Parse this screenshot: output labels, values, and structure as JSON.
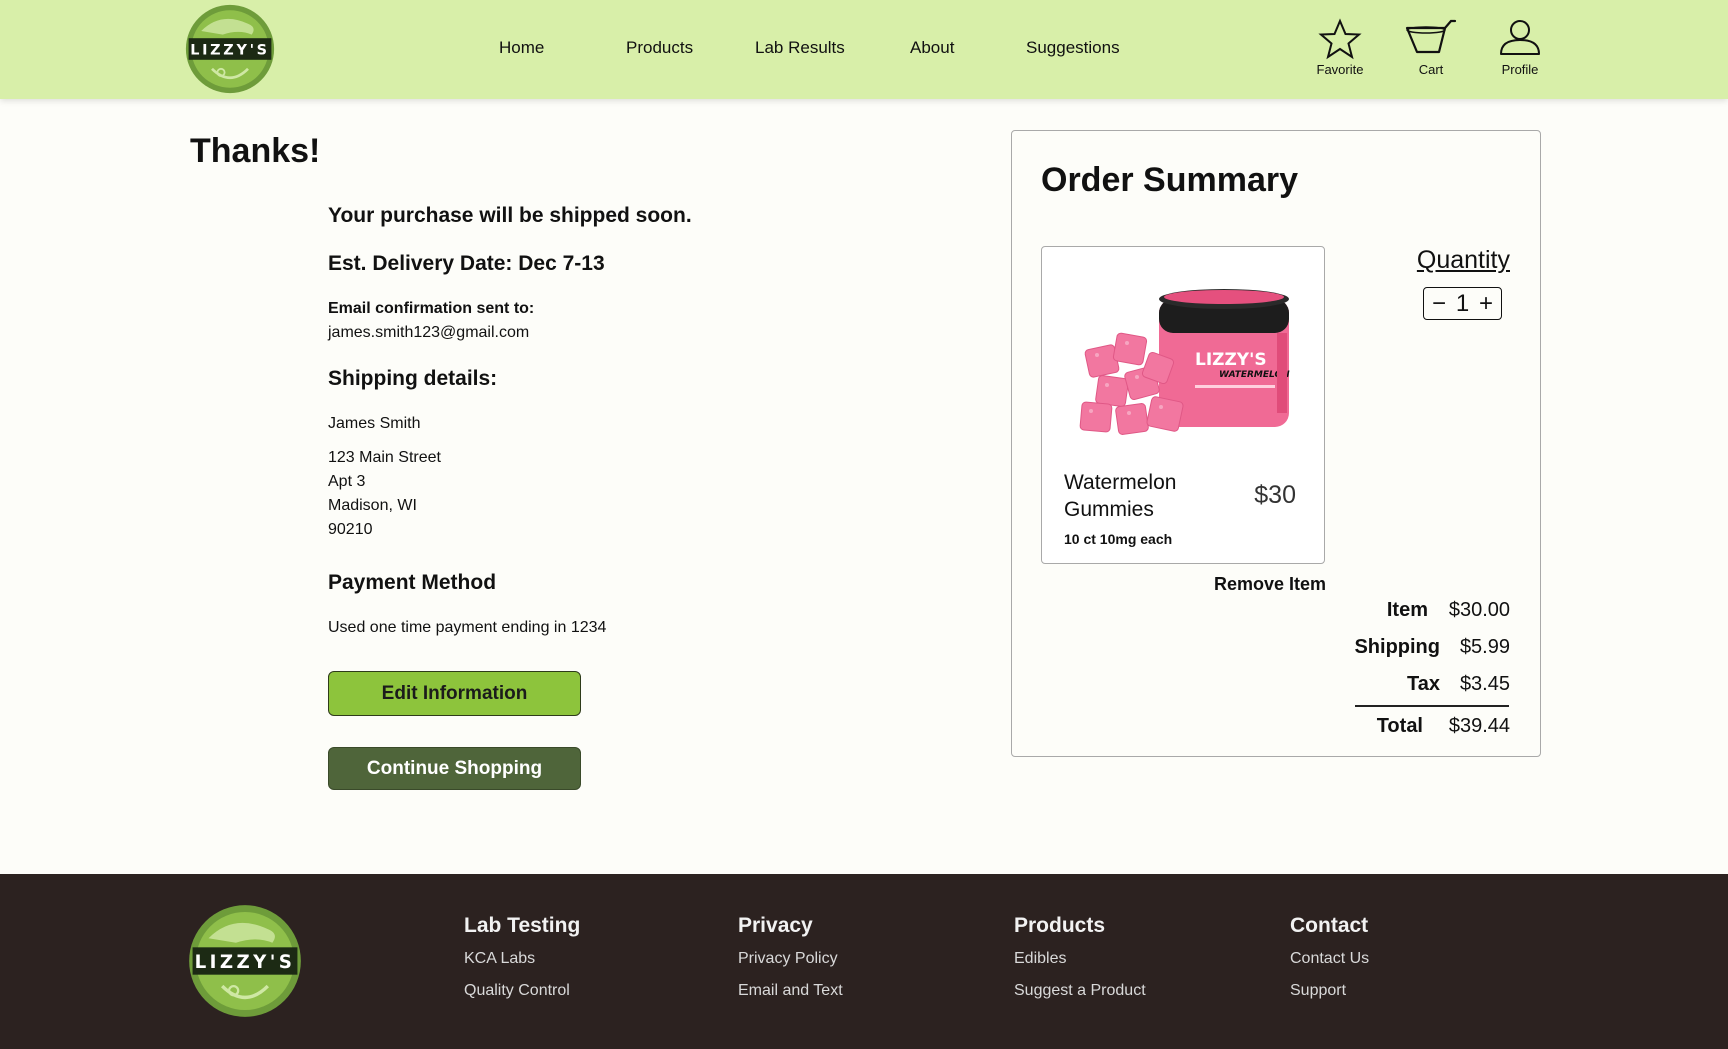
{
  "brand": {
    "logo_text": "LIZZY'S",
    "primary_color": "#d8efa9",
    "accent_green": "#8dc43c",
    "dark_green": "#4f653a"
  },
  "nav": {
    "links": [
      "Home",
      "Products",
      "Lab Results",
      "About",
      "Suggestions"
    ],
    "icons": [
      {
        "icon": "star-icon",
        "label": "Favorite"
      },
      {
        "icon": "cart-icon",
        "label": "Cart"
      },
      {
        "icon": "profile-icon",
        "label": "Profile"
      }
    ]
  },
  "confirmation": {
    "title": "Thanks!",
    "ship_message": "Your purchase will be shipped soon.",
    "delivery": "Est. Delivery Date: Dec 7-13",
    "email_label": "Email confirmation sent to:",
    "email": "james.smith123@gmail.com",
    "shipping_title": "Shipping details:",
    "name": "James Smith",
    "address": [
      "123 Main Street",
      "Apt 3",
      "Madison, WI",
      "90210"
    ],
    "payment_title": "Payment Method",
    "payment_text": "Used one time payment ending in 1234",
    "edit_button": "Edit Information",
    "continue_button": "Continue Shopping"
  },
  "summary": {
    "title": "Order Summary",
    "product": {
      "name": "Watermelon Gummies",
      "price": "$30",
      "desc": "10 ct 10mg each",
      "jar_label": "LIZZY'S",
      "jar_flavor": "WATERMELON"
    },
    "quantity_label": "Quantity",
    "quantity": "1",
    "minus": "−",
    "plus": "+",
    "remove": "Remove Item",
    "lines": {
      "item_label": "Item",
      "item_value": "$30.00",
      "shipping_label": "Shipping",
      "shipping_value": "$5.99",
      "tax_label": "Tax",
      "tax_value": "$3.45",
      "total_label": "Total",
      "total_value": "$39.44"
    }
  },
  "footer": {
    "columns": [
      {
        "title": "Lab Testing",
        "links": [
          "KCA Labs",
          "Quality Control"
        ]
      },
      {
        "title": "Privacy",
        "links": [
          "Privacy Policy",
          "Email and Text"
        ]
      },
      {
        "title": "Products",
        "links": [
          "Edibles",
          "Suggest a Product"
        ]
      },
      {
        "title": "Contact",
        "links": [
          "Contact Us",
          "Support"
        ]
      }
    ]
  }
}
